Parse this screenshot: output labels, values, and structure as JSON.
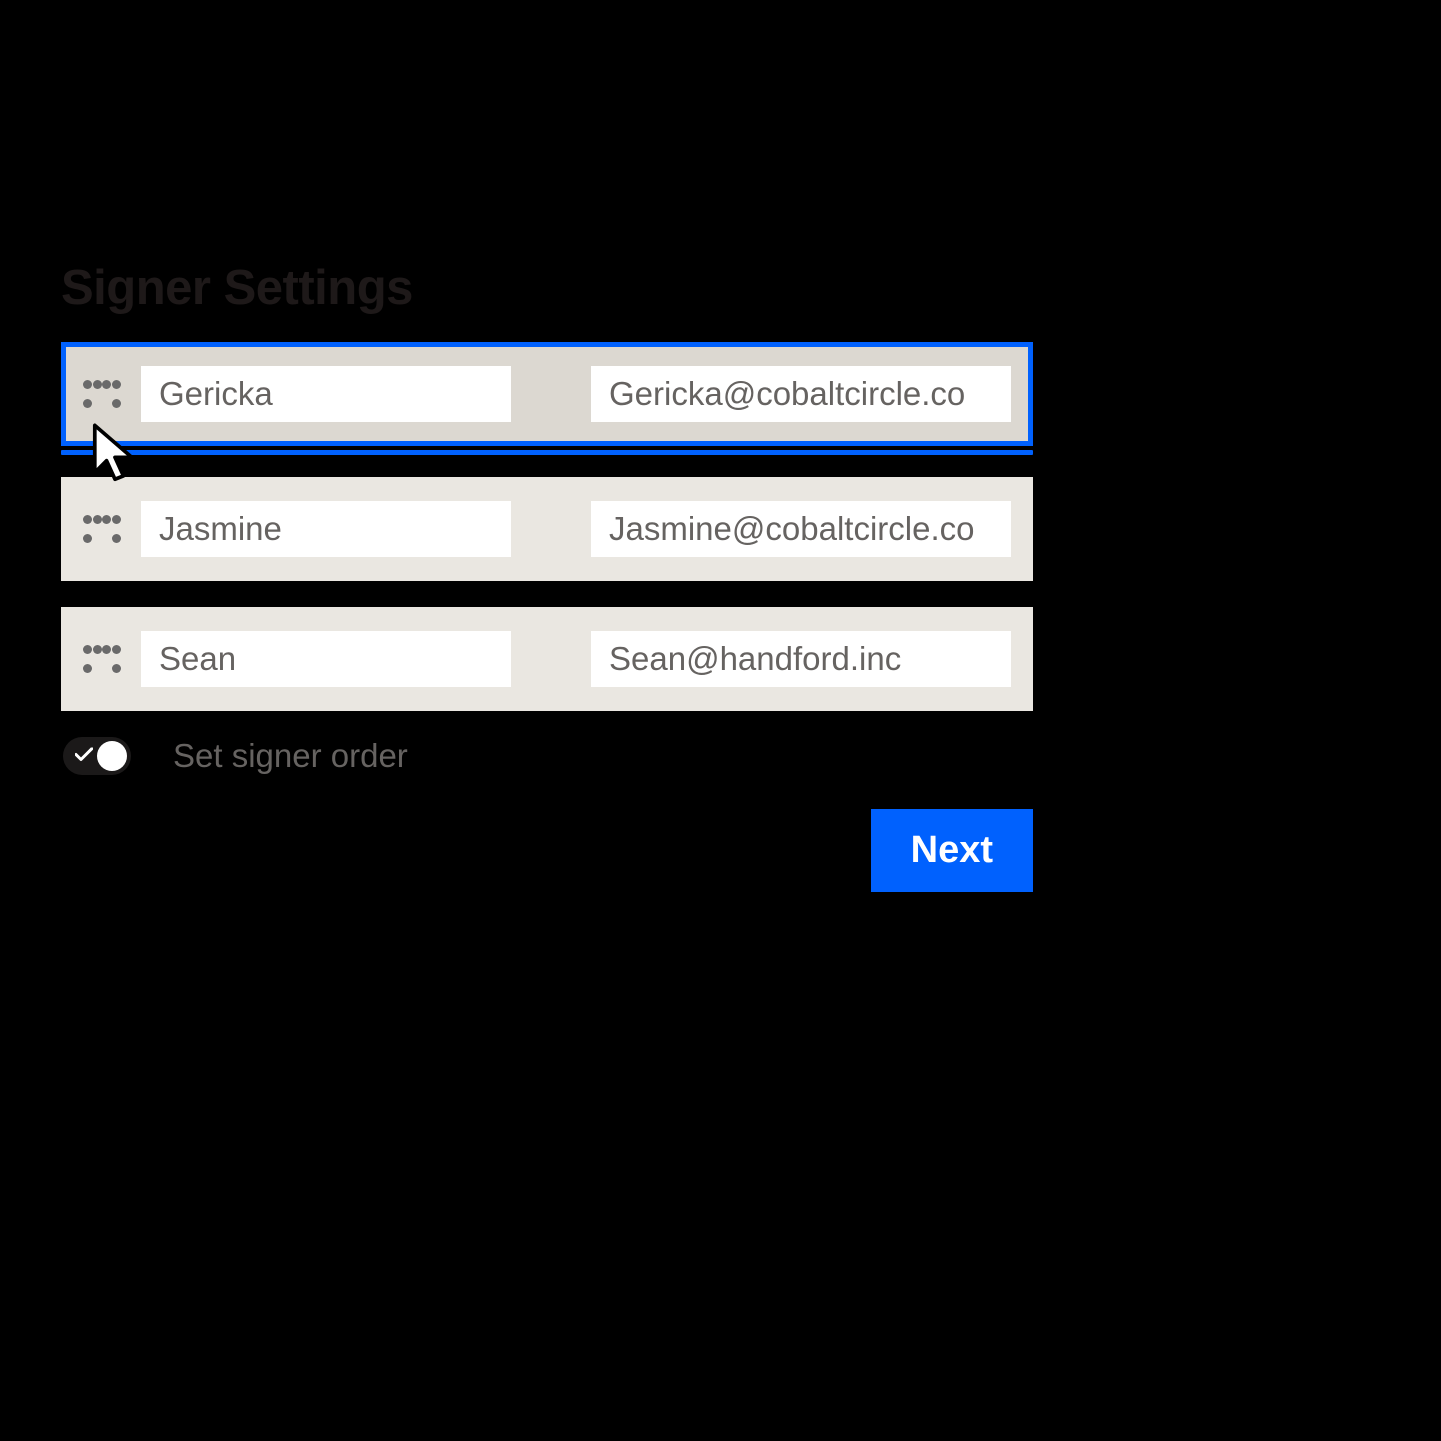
{
  "title": "Signer Settings",
  "signers": [
    {
      "name": "Gericka",
      "email": "Gericka@cobaltcircle.co",
      "selected": true
    },
    {
      "name": "Jasmine",
      "email": "Jasmine@cobaltcircle.co",
      "selected": false
    },
    {
      "name": "Sean",
      "email": "Sean@handford.inc",
      "selected": false
    }
  ],
  "toggle": {
    "label": "Set signer order",
    "on": true
  },
  "next_label": "Next",
  "colors": {
    "accent": "#0061fe",
    "row_bg": "#eae7e1",
    "row_selected_bg": "#dcd8d1"
  }
}
